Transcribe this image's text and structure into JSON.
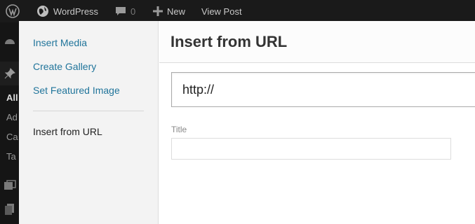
{
  "adminbar": {
    "site_name": "WordPress",
    "comments_count": "0",
    "new_label": "New",
    "view_post_label": "View Post"
  },
  "leftmenu": {
    "items": [
      "All",
      "Ad",
      "Ca",
      "Ta"
    ]
  },
  "media_modal": {
    "menu": {
      "items": [
        "Insert Media",
        "Create Gallery",
        "Set Featured Image"
      ],
      "active_item": "Insert from URL"
    },
    "frame_title": "Insert from URL",
    "url_input": {
      "value": "http://"
    },
    "title_field": {
      "label": "Title",
      "value": ""
    }
  }
}
